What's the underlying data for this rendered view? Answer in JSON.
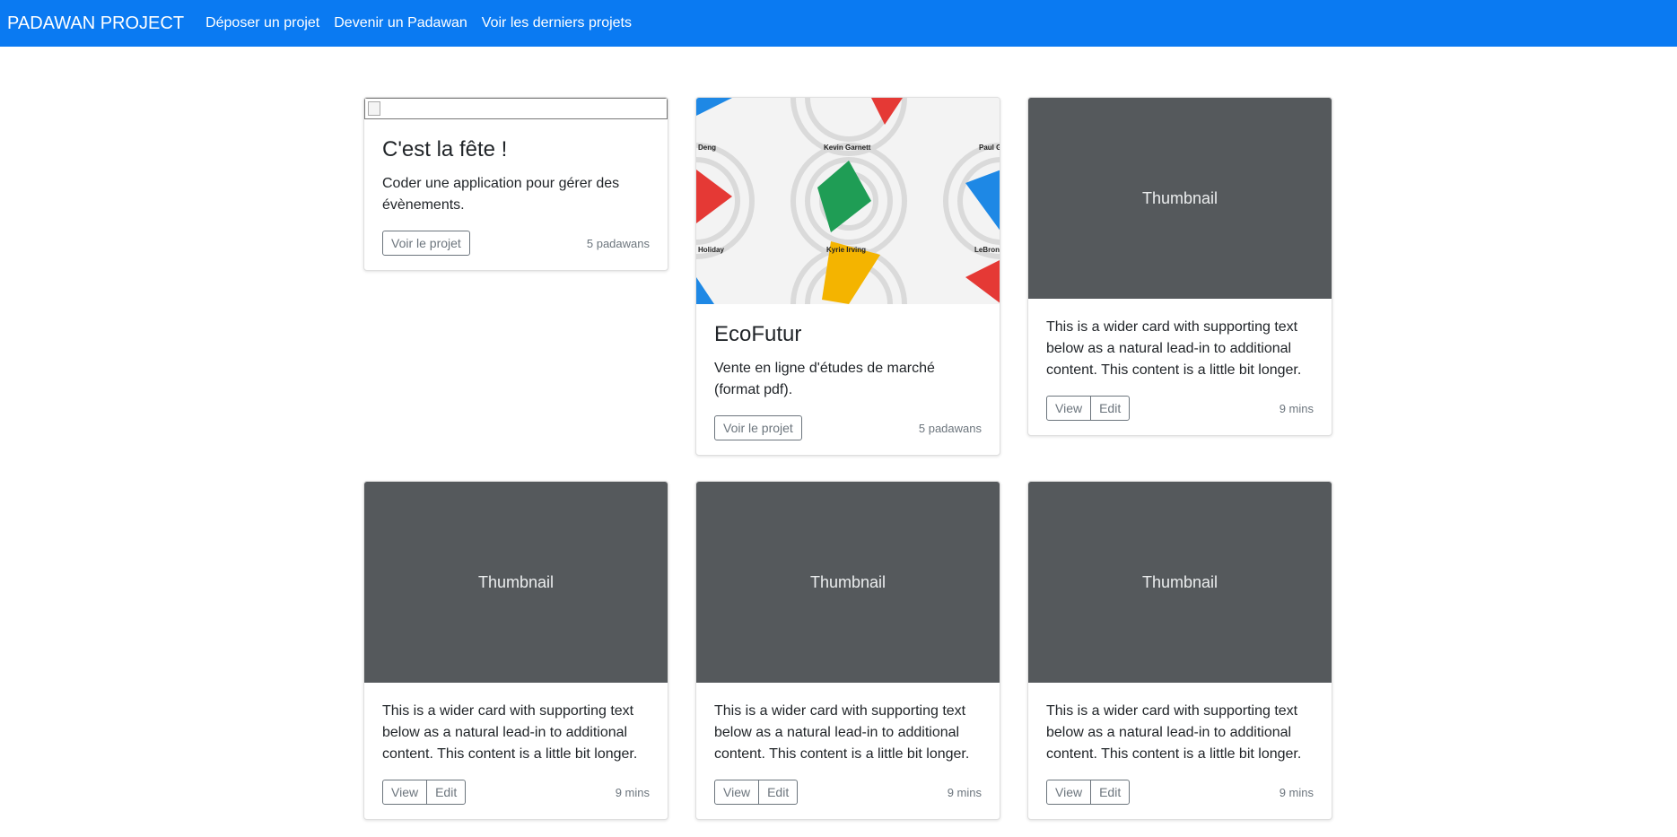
{
  "navbar": {
    "brand": "PADAWAN PROJECT",
    "links": [
      "Déposer un projet",
      "Devenir un Padawan",
      "Voir les derniers projets"
    ],
    "color": "#0a7af2"
  },
  "cards": [
    {
      "title": "C'est la fête !",
      "text": "Coder une application pour gérer des évènements.",
      "button": "Voir le projet",
      "meta": "5 padawans",
      "image": "broken-image-icon"
    },
    {
      "title": "EcoFutur",
      "text": "Vente en ligne d'études de marché (format pdf).",
      "button": "Voir le projet",
      "meta": "5 padawans",
      "image_labels": [
        "Deng",
        "Kevin Garnett",
        "Paul G",
        "Holiday",
        "Kyrie Irving",
        "LeBron"
      ]
    },
    {
      "thumbnail": "Thumbnail",
      "text": "This is a wider card with supporting text below as a natural lead-in to additional content. This content is a little bit longer.",
      "view": "View",
      "edit": "Edit",
      "meta": "9 mins"
    },
    {
      "thumbnail": "Thumbnail",
      "text": "This is a wider card with supporting text below as a natural lead-in to additional content. This content is a little bit longer.",
      "view": "View",
      "edit": "Edit",
      "meta": "9 mins"
    },
    {
      "thumbnail": "Thumbnail",
      "text": "This is a wider card with supporting text below as a natural lead-in to additional content. This content is a little bit longer.",
      "view": "View",
      "edit": "Edit",
      "meta": "9 mins"
    },
    {
      "thumbnail": "Thumbnail",
      "text": "This is a wider card with supporting text below as a natural lead-in to additional content. This content is a little bit longer.",
      "view": "View",
      "edit": "Edit",
      "meta": "9 mins"
    }
  ]
}
